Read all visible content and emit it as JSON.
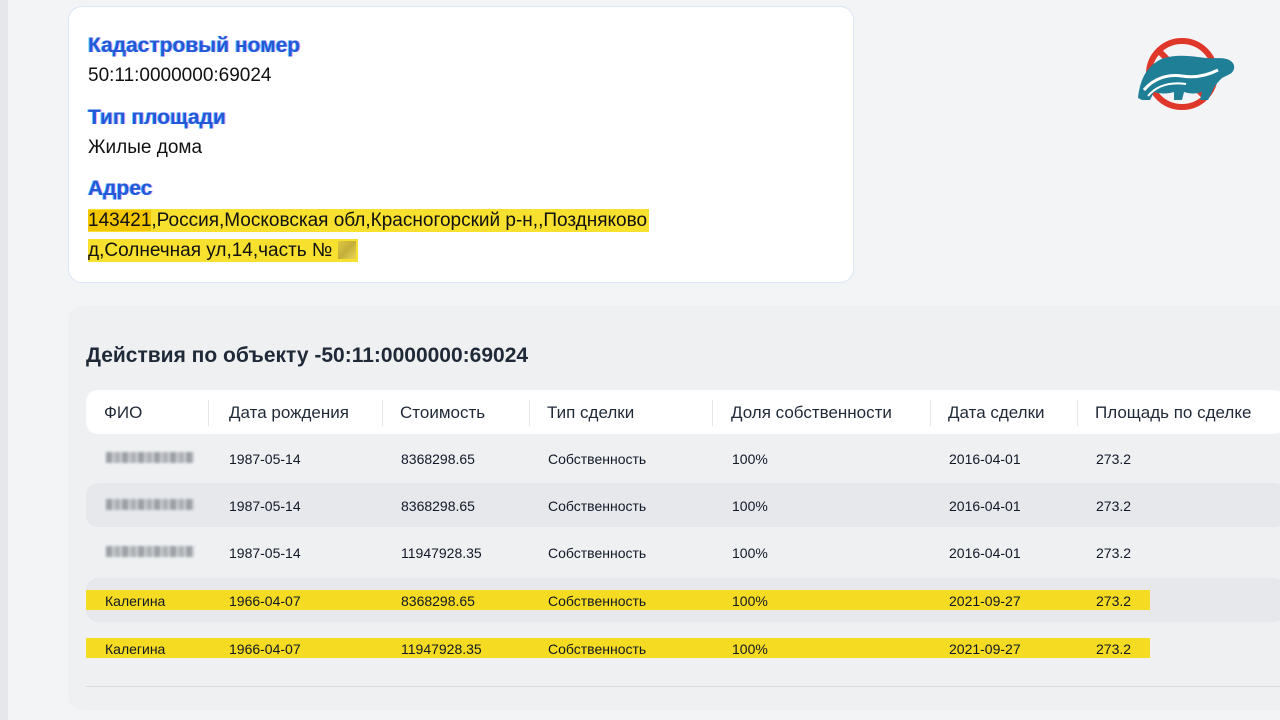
{
  "card": {
    "cadastral_label": "Кадастровый номер",
    "cadastral_value": "50:11:0000000:69024",
    "area_type_label": "Тип площади",
    "area_type_value": "Жилые дома",
    "address_label": "Адрес",
    "address_zip": "143421",
    "address_line1_rest": ",Россия,Московская обл,Красногорский р-н,,Поздняково",
    "address_line2": "д,Солнечная ул,14,часть №"
  },
  "actions": {
    "title": "Действия по объекту -50:11:0000000:69024",
    "columns": [
      "ФИО",
      "Дата рождения",
      "Стоимость",
      "Тип сделки",
      "Доля собственности",
      "Дата сделки",
      "Площадь по сделке"
    ],
    "rows": [
      {
        "fio": "",
        "birth": "1987-05-14",
        "cost": "8368298.65",
        "deal_type": "Собственность",
        "share": "100%",
        "deal_date": "2016-04-01",
        "area": "273.2",
        "blurred": true,
        "highlighted": false
      },
      {
        "fio": "",
        "birth": "1987-05-14",
        "cost": "8368298.65",
        "deal_type": "Собственность",
        "share": "100%",
        "deal_date": "2016-04-01",
        "area": "273.2",
        "blurred": true,
        "highlighted": false
      },
      {
        "fio": "",
        "birth": "1987-05-14",
        "cost": "11947928.35",
        "deal_type": "Собственность",
        "share": "100%",
        "deal_date": "2016-04-01",
        "area": "273.2",
        "blurred": true,
        "highlighted": false
      },
      {
        "fio": "Калегина",
        "birth": "1966-04-07",
        "cost": "8368298.65",
        "deal_type": "Собственность",
        "share": "100%",
        "deal_date": "2021-09-27",
        "area": "273.2",
        "blurred": false,
        "highlighted": true
      },
      {
        "fio": "Калегина",
        "birth": "1966-04-07",
        "cost": "11947928.35",
        "deal_type": "Собственность",
        "share": "100%",
        "deal_date": "2021-09-27",
        "area": "273.2",
        "blurred": false,
        "highlighted": true
      }
    ]
  },
  "colors": {
    "label_blue": "#2458d6",
    "highlight_yellow": "#f5dc22",
    "logo_red": "#e0372b",
    "logo_teal": "#1f7f96"
  },
  "icons": {
    "logo": "crossed-out-bear-logo"
  }
}
